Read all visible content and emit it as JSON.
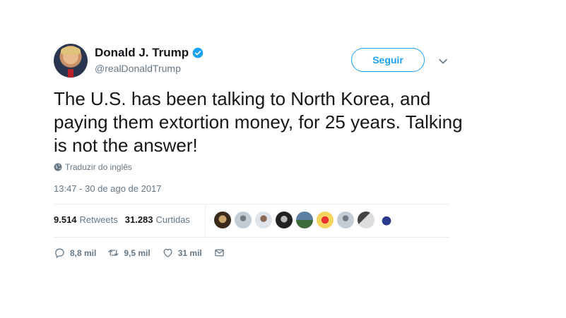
{
  "author": {
    "name": "Donald J. Trump",
    "handle": "@realDonaldTrump"
  },
  "follow_label": "Seguir",
  "tweet_text": "The U.S. has been talking to North Korea, and paying them extortion money, for 25 years. Talking is not the answer!",
  "translate_label": "Traduzir do inglês",
  "timestamp": "13:47 - 30 de ago de 2017",
  "stats": {
    "retweets_count": "9.514",
    "retweets_label": "Retweets",
    "likes_count": "31.283",
    "likes_label": "Curtidas"
  },
  "actions": {
    "replies": "8,8 mil",
    "retweets": "9,5 mil",
    "likes": "31 mil"
  },
  "colors": {
    "accent": "#1da1f2",
    "muted": "#657786",
    "text": "#14171a"
  }
}
